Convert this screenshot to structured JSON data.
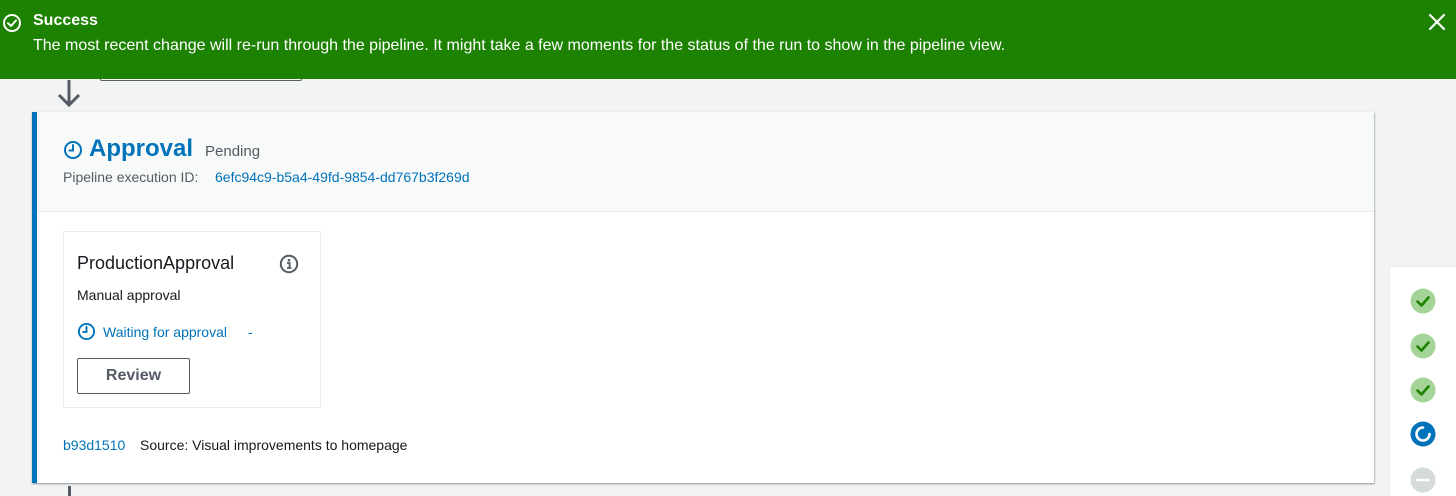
{
  "flash": {
    "title": "Success",
    "message": "The most recent change will re-run through the pipeline. It might take a few moments for the status of the run to show in the pipeline view.",
    "type": "success",
    "color": "#1d8102"
  },
  "stage": {
    "name": "Approval",
    "status": "Pending",
    "execution_label": "Pipeline execution ID:",
    "execution_id": "6efc94c9-b5a4-49fd-9854-dd767b3f269d",
    "accent_color": "#0073bb"
  },
  "action": {
    "name": "ProductionApproval",
    "provider": "Manual approval",
    "status": "Waiting for approval",
    "status_separator": "-",
    "review_label": "Review"
  },
  "source": {
    "commit_id": "b93d1510",
    "message": "Source: Visual improvements to homepage"
  },
  "progress_steps": [
    {
      "state": "succeeded",
      "icon": "check-circle-icon"
    },
    {
      "state": "succeeded",
      "icon": "check-circle-icon"
    },
    {
      "state": "succeeded",
      "icon": "check-circle-icon"
    },
    {
      "state": "in-progress",
      "icon": "spinner-icon"
    },
    {
      "state": "not-started",
      "icon": "minus-circle-icon"
    }
  ]
}
